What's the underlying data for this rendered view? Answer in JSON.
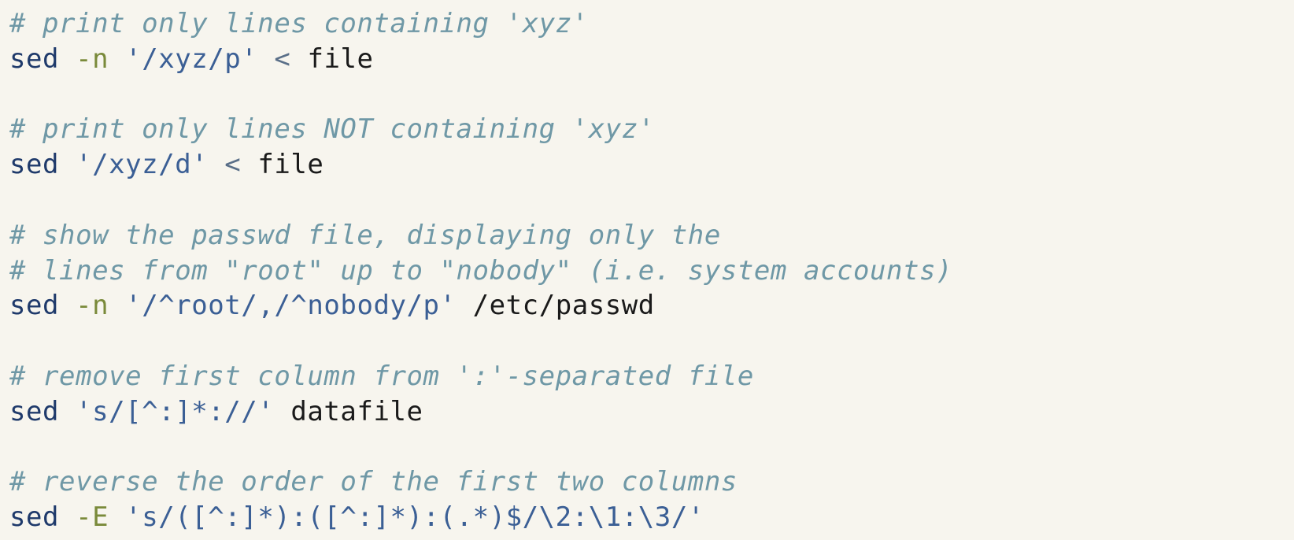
{
  "lines": [
    {
      "comment": "# print only lines containing 'xyz'"
    },
    {
      "cmd": "sed",
      "flag": "-n",
      "str": "'/xyz/p'",
      "op": "<",
      "arg": "file"
    },
    {},
    {
      "comment": "# print only lines NOT containing 'xyz'"
    },
    {
      "cmd": "sed",
      "flag": "",
      "str": "'/xyz/d'",
      "op": "<",
      "arg": "file"
    },
    {},
    {
      "comment": "# show the passwd file, displaying only the"
    },
    {
      "comment": "# lines from \"root\" up to \"nobody\" (i.e. system accounts)"
    },
    {
      "cmd": "sed",
      "flag": "-n",
      "str": "'/^root/,/^nobody/p'",
      "op": "",
      "arg": "/etc/passwd"
    },
    {},
    {
      "comment": "# remove first column from ':'-separated file"
    },
    {
      "cmd": "sed",
      "flag": "",
      "str": "'s/[^:]*://'",
      "op": "",
      "arg": "datafile"
    },
    {},
    {
      "comment": "# reverse the order of the first two columns"
    },
    {
      "cmd": "sed",
      "flag": "-E",
      "str": "'s/([^:]*):([^:]*):(.*)$/\\2:\\1:\\3/'",
      "op": "",
      "arg": ""
    }
  ]
}
